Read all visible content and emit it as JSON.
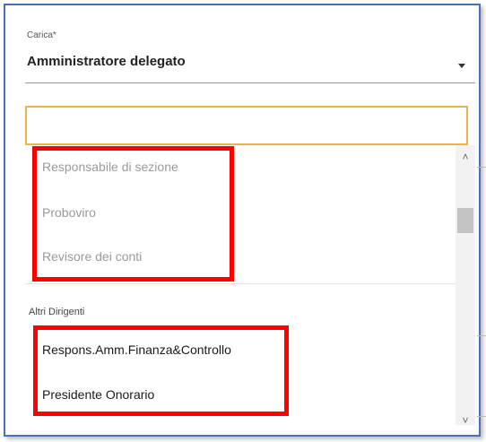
{
  "field": {
    "label": "Carica*",
    "value": "Amministratore delegato"
  },
  "search": {
    "placeholder": ""
  },
  "options_group1": [
    {
      "label": "Responsabile di sezione"
    },
    {
      "label": "Proboviro"
    },
    {
      "label": "Revisore dei conti"
    }
  ],
  "group2": {
    "label": "Altri Dirigenti",
    "options": [
      {
        "label": "Respons.Amm.Finanza&Controllo"
      },
      {
        "label": "Presidente Onorario"
      }
    ]
  },
  "icons": {
    "caret": "chevron-down-icon",
    "scroll_up": "chevron-up-icon",
    "scroll_down": "chevron-down-icon"
  },
  "colors": {
    "highlight": "#ff0000",
    "search_border": "#e6b64c",
    "frame_border": "#4a6fb5"
  }
}
